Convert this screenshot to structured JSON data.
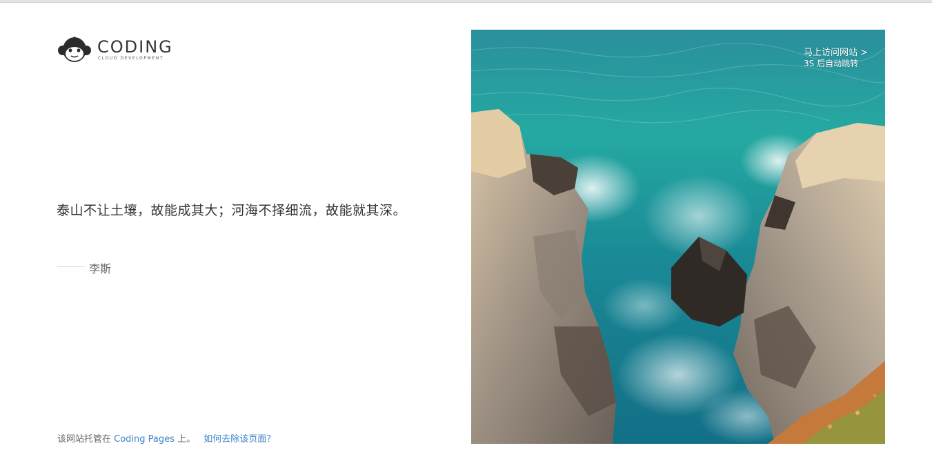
{
  "brand": {
    "name": "CODING",
    "tagline": "CLOUD DEVELOPMENT",
    "logo_icon": "monkey-head-icon"
  },
  "quote": {
    "text": "泰山不让土壤，故能成其大；河海不择细流，故能就其深。",
    "author": "李斯"
  },
  "redirect": {
    "visit_label": "马上访问网站 >",
    "countdown_text": "3S 后自动跳转"
  },
  "footer": {
    "prefix": "该网站托管在",
    "service_link": "Coding Pages",
    "suffix": "上。",
    "remove_link": "如何去除该页面？"
  },
  "colors": {
    "text_main": "#333333",
    "text_muted": "#666666",
    "link": "#3c83c9",
    "sea_teal": "#1a8f95"
  }
}
